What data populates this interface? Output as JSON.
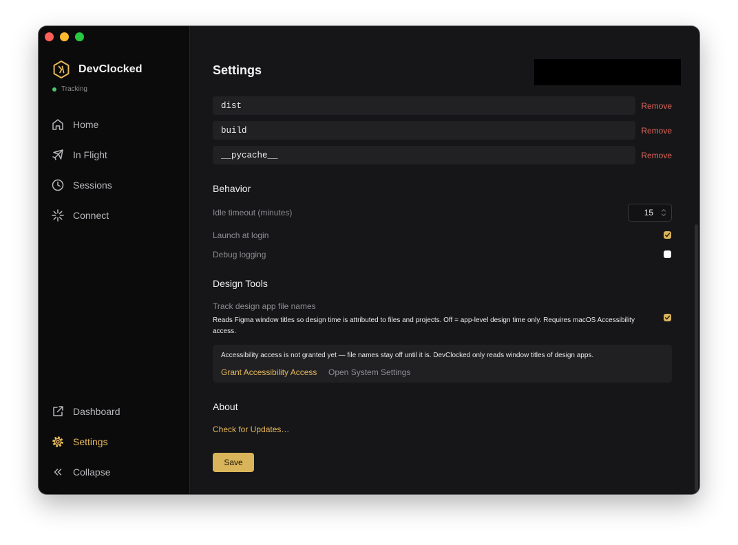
{
  "app": {
    "name": "DevClocked",
    "status": "Tracking",
    "colors": {
      "accent": "#d9b45a",
      "remove": "#e0645a",
      "status_dot": "#4ec46a"
    }
  },
  "sidebar": {
    "items": [
      {
        "label": "Home",
        "icon": "home-icon"
      },
      {
        "label": "In Flight",
        "icon": "airplane-icon"
      },
      {
        "label": "Sessions",
        "icon": "clock-icon"
      },
      {
        "label": "Connect",
        "icon": "sparkle-icon"
      }
    ],
    "bottom_items": [
      {
        "label": "Dashboard",
        "icon": "external-link-icon"
      },
      {
        "label": "Settings",
        "icon": "gear-icon",
        "active": true
      },
      {
        "label": "Collapse",
        "icon": "double-chevron-left-icon"
      }
    ]
  },
  "main": {
    "title": "Settings",
    "exclusions": [
      {
        "value": "dist",
        "remove_label": "Remove"
      },
      {
        "value": "build",
        "remove_label": "Remove"
      },
      {
        "value": "__pycache__",
        "remove_label": "Remove"
      }
    ],
    "behavior": {
      "title": "Behavior",
      "idle_timeout_label": "Idle timeout (minutes)",
      "idle_timeout_value": "15",
      "launch_at_login_label": "Launch at login",
      "launch_at_login": true,
      "debug_logging_label": "Debug logging",
      "debug_logging": false
    },
    "design_tools": {
      "title": "Design Tools",
      "track_label": "Track design app file names",
      "track_description": "Reads Figma window titles so design time is attributed to files and projects. Off = app-level design time only. Requires macOS Accessibility access.",
      "track_enabled": true,
      "notice_text": "Accessibility access is not granted yet — file names stay off until it is. DevClocked only reads window titles of design apps.",
      "grant_label": "Grant Accessibility Access",
      "open_settings_label": "Open System Settings"
    },
    "about": {
      "title": "About",
      "check_updates_label": "Check for Updates…"
    },
    "save_label": "Save"
  }
}
